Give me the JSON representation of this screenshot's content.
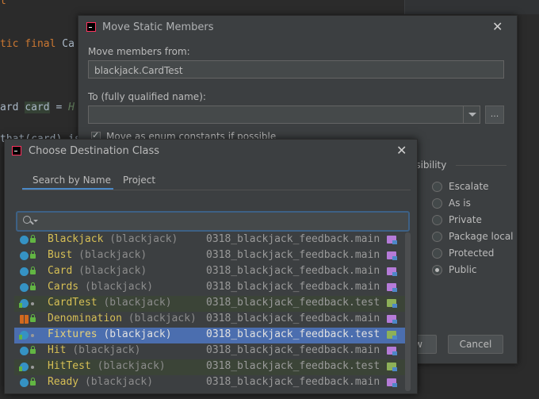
{
  "editor": {
    "lines": [
      {
        "text": "l",
        "kind": "plain"
      },
      {
        "text": "tic final Ca",
        "kind": "kw"
      },
      {
        "text": "ard card = H",
        "kind": "assign"
      },
      {
        "text": "that(card).is",
        "kind": "plain"
      }
    ]
  },
  "move_dialog": {
    "title": "Move Static Members",
    "from_label": "Move members from:",
    "from_value": "blackjack.CardTest",
    "to_label": "To (fully qualified name):",
    "to_value": "",
    "browse_button": "...",
    "enum_checkbox_label": "Move as enum constants if possible",
    "enum_checked": true,
    "visibility_title": "isibility",
    "visibility_options": [
      "Escalate",
      "As is",
      "Private",
      "Package local",
      "Protected",
      "Public"
    ],
    "visibility_selected": "Public",
    "ok_button": "w",
    "cancel_button": "Cancel"
  },
  "choose_dialog": {
    "title": "Choose Destination Class",
    "tabs": [
      "Search by Name",
      "Project"
    ],
    "active_tab": "Search by Name",
    "search_value": "",
    "classes": [
      {
        "name": "Blackjack",
        "package": "(blackjack)",
        "module": "0318_blackjack_feedback.main",
        "kind": "class",
        "test": false
      },
      {
        "name": "Bust",
        "package": "(blackjack)",
        "module": "0318_blackjack_feedback.main",
        "kind": "class",
        "test": false
      },
      {
        "name": "Card",
        "package": "(blackjack)",
        "module": "0318_blackjack_feedback.main",
        "kind": "class",
        "test": false
      },
      {
        "name": "Cards",
        "package": "(blackjack)",
        "module": "0318_blackjack_feedback.main",
        "kind": "class",
        "test": false
      },
      {
        "name": "CardTest",
        "package": "(blackjack)",
        "module": "0318_blackjack_feedback.test",
        "kind": "class",
        "test": true
      },
      {
        "name": "Denomination",
        "package": "(blackjack)",
        "module": "0318_blackjack_feedback.main",
        "kind": "enum",
        "test": false
      },
      {
        "name": "Fixtures",
        "package": "(blackjack)",
        "module": "0318_blackjack_feedback.test",
        "kind": "class",
        "test": true,
        "selected": true
      },
      {
        "name": "Hit",
        "package": "(blackjack)",
        "module": "0318_blackjack_feedback.main",
        "kind": "class",
        "test": false
      },
      {
        "name": "HitTest",
        "package": "(blackjack)",
        "module": "0318_blackjack_feedback.test",
        "kind": "class",
        "test": true
      },
      {
        "name": "Ready",
        "package": "(blackjack)",
        "module": "0318_blackjack_feedback.main",
        "kind": "class",
        "test": false
      }
    ]
  }
}
